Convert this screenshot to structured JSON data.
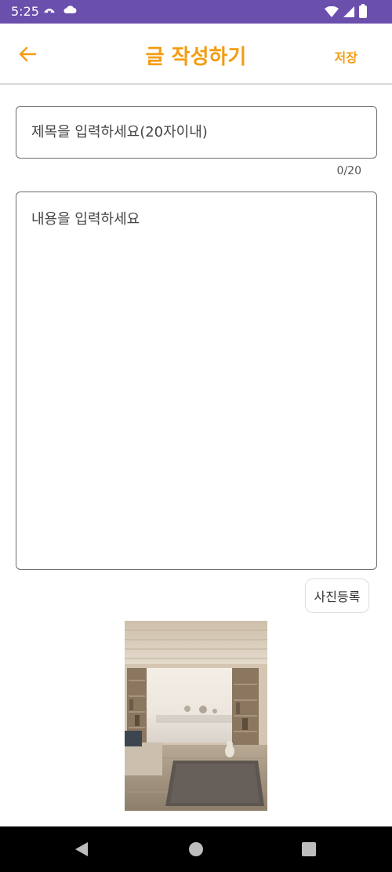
{
  "status_bar": {
    "time": "5:25",
    "background": "#6a4fad",
    "icons": [
      "dots-icon",
      "cloud-icon",
      "wifi-icon",
      "signal-icon",
      "battery-icon"
    ]
  },
  "app_bar": {
    "back_icon": "arrow-left-icon",
    "title": "글 작성하기",
    "save_label": "저장",
    "accent_color": "#f39c12"
  },
  "form": {
    "title_placeholder": "제목을 입력하세요(20자이내)",
    "title_value": "",
    "title_counter": "0/20",
    "content_placeholder": "내용을 입력하세요",
    "content_value": "",
    "photo_button_label": "사진등록"
  },
  "attached_photo": {
    "description": "room-with-window-and-cat"
  },
  "nav_bar": {
    "icons": [
      "nav-back-icon",
      "nav-home-icon",
      "nav-recent-icon"
    ]
  }
}
